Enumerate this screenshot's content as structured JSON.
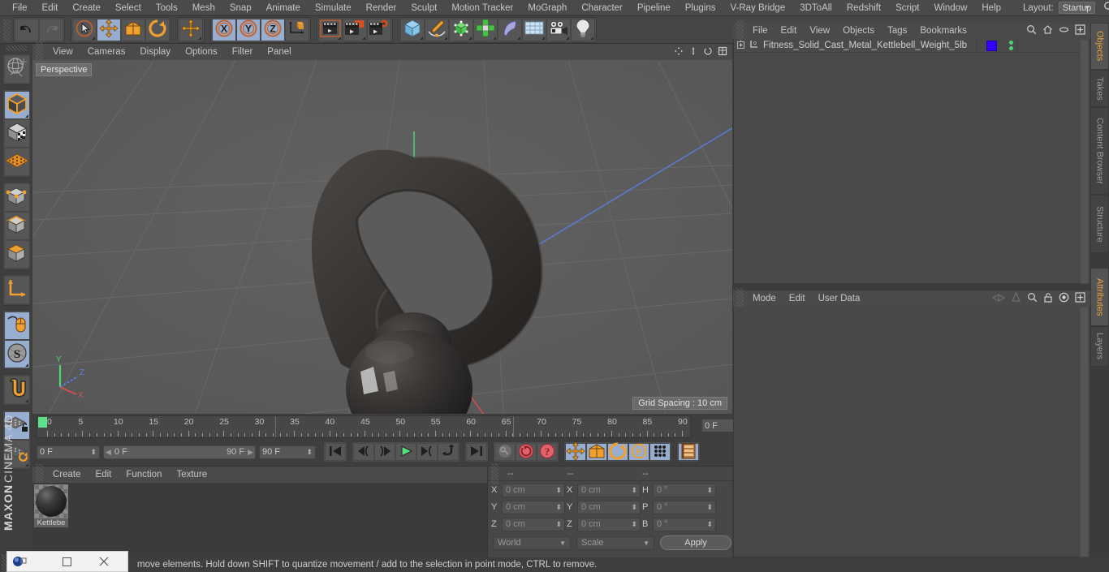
{
  "app": {
    "brand_top": "MAXON",
    "brand_bottom": "CINEMA 4D"
  },
  "menubar": {
    "items": [
      "File",
      "Edit",
      "Create",
      "Select",
      "Tools",
      "Mesh",
      "Snap",
      "Animate",
      "Simulate",
      "Render",
      "Sculpt",
      "Motion Tracker",
      "MoGraph",
      "Character",
      "Pipeline",
      "Plugins",
      "V-Ray Bridge",
      "3DToAll",
      "Redshift",
      "Script",
      "Window",
      "Help"
    ],
    "layout_label": "Layout:",
    "layout_value": "Startup",
    "search_icon": "search-icon"
  },
  "toolbar": {
    "groups": [
      {
        "name": "undo-redo",
        "buttons": [
          {
            "name": "undo-button",
            "icon": "undo-arrow-icon",
            "active": false,
            "corner": false
          },
          {
            "name": "redo-button",
            "icon": "redo-arrow-icon",
            "active": false,
            "corner": false
          }
        ]
      },
      {
        "name": "transform-tools",
        "buttons": [
          {
            "name": "select-tool",
            "icon": "cursor-circle-icon",
            "active": false,
            "corner": true
          },
          {
            "name": "move-tool",
            "icon": "move-arrows-icon",
            "active": true,
            "corner": false
          },
          {
            "name": "scale-tool",
            "icon": "scale-box-icon",
            "active": false,
            "corner": false
          },
          {
            "name": "rotate-tool",
            "icon": "rotate-circle-icon",
            "active": false,
            "corner": false
          }
        ]
      },
      {
        "name": "cursor-group",
        "buttons": [
          {
            "name": "move-cursor-tool",
            "icon": "move-arrows-icon",
            "active": false,
            "corner": true
          }
        ]
      },
      {
        "name": "axis-locks",
        "buttons": [
          {
            "name": "lock-x-axis",
            "icon": "x-axis-icon",
            "active": true,
            "corner": false
          },
          {
            "name": "lock-y-axis",
            "icon": "y-axis-icon",
            "active": true,
            "corner": false
          },
          {
            "name": "lock-z-axis",
            "icon": "z-axis-icon",
            "active": true,
            "corner": false
          },
          {
            "name": "world-object-coordinates",
            "icon": "world-axis-cube-icon",
            "active": false,
            "corner": false
          }
        ]
      },
      {
        "name": "render-group",
        "buttons": [
          {
            "name": "render-view-button",
            "icon": "clapboard-frame-icon",
            "active": false,
            "corner": true
          },
          {
            "name": "render-to-picture-viewer-button",
            "icon": "clapboard-picture-icon",
            "active": false,
            "corner": true
          },
          {
            "name": "render-settings-button",
            "icon": "clapboard-gear-icon",
            "active": false,
            "corner": false
          }
        ]
      },
      {
        "name": "create-group",
        "buttons": [
          {
            "name": "add-cube-primitive",
            "icon": "blue-cube-icon",
            "active": false,
            "corner": true
          },
          {
            "name": "add-spline",
            "icon": "pen-spline-icon",
            "active": false,
            "corner": true
          },
          {
            "name": "add-generator",
            "icon": "green-cube-icon",
            "active": false,
            "corner": true
          },
          {
            "name": "add-mograph-cloner",
            "icon": "green-cluster-icon",
            "active": false,
            "corner": true
          },
          {
            "name": "add-deformer",
            "icon": "bend-deformer-icon",
            "active": false,
            "corner": true
          },
          {
            "name": "add-environment",
            "icon": "floor-grid-icon",
            "active": false,
            "corner": true
          },
          {
            "name": "add-camera",
            "icon": "camera-icon",
            "active": false,
            "corner": true
          },
          {
            "name": "add-light",
            "icon": "light-bulb-icon",
            "active": false,
            "corner": true
          }
        ]
      }
    ]
  },
  "left_tools": [
    {
      "name": "live-selection-tool",
      "icon": "globe-sphere-icon",
      "active": false,
      "corner": false
    },
    {
      "name": "model-mode-tool",
      "icon": "orange-outline-cube-icon",
      "active": true,
      "corner": true
    },
    {
      "name": "texture-mode-tool",
      "icon": "checker-cube-icon",
      "active": false,
      "corner": false
    },
    {
      "name": "uv-mesh-tool",
      "icon": "orange-grid-mesh-icon",
      "active": false,
      "corner": false
    },
    {
      "name": "points-mode-tool",
      "icon": "points-cube-icon",
      "active": false,
      "corner": false
    },
    {
      "name": "edges-mode-tool",
      "icon": "edges-cube-icon",
      "active": false,
      "corner": false
    },
    {
      "name": "polygons-mode-tool",
      "icon": "polygon-cube-icon",
      "active": false,
      "corner": false
    },
    {
      "name": "axis-modify-tool",
      "icon": "orange-axis-icon",
      "active": false,
      "corner": false
    },
    {
      "name": "viewport-solo-tool",
      "icon": "mouse-icon",
      "active": true,
      "corner": false
    },
    {
      "name": "enable-snapping-tool",
      "icon": "s-snap-icon",
      "active": true,
      "corner": true
    },
    {
      "name": "magnet-tool",
      "icon": "orange-magnet-icon",
      "active": false,
      "corner": true
    },
    {
      "name": "lock-workplane-tool",
      "icon": "workplane-lock-icon",
      "active": true,
      "corner": false
    },
    {
      "name": "workplane-rotate-tool",
      "icon": "workplane-rotate-icon",
      "active": false,
      "corner": true
    }
  ],
  "viewport": {
    "menu": [
      "View",
      "Cameras",
      "Display",
      "Options",
      "Filter",
      "Panel"
    ],
    "label": "Perspective",
    "grid_spacing": "Grid Spacing : 10 cm",
    "axis_labels": {
      "x": "X",
      "y": "Y",
      "z": "Z"
    },
    "axis_colors": {
      "x": "#d94f4f",
      "y": "#4fd472",
      "z": "#5b7fe0"
    },
    "corner_icons": [
      "pan-view-icon",
      "zoom-view-icon",
      "rotate-view-icon",
      "maximize-view-icon"
    ]
  },
  "timeline": {
    "tick_labels": [
      "0",
      "5",
      "10",
      "15",
      "20",
      "25",
      "30",
      "35",
      "40",
      "45",
      "50",
      "55",
      "60",
      "65",
      "70",
      "75",
      "80",
      "85",
      "90"
    ],
    "current_frame_field": "0 F",
    "start_field": "0 F",
    "range_start": "0 F",
    "range_end": "90 F",
    "end_field": "90 F",
    "buttons": [
      {
        "name": "go-to-start-button",
        "icon": "skip-start-icon",
        "active": false
      },
      {
        "name": "play-backwards-frame-button",
        "icon": "step-back-icon",
        "active": false
      },
      {
        "name": "go-to-previous-key-button",
        "icon": "prev-key-icon",
        "active": false
      },
      {
        "name": "play-button",
        "icon": "play-icon",
        "active": false
      },
      {
        "name": "go-to-next-key-button",
        "icon": "next-key-icon",
        "active": false
      },
      {
        "name": "play-forwards-button",
        "icon": "loop-arrow-icon",
        "active": false
      },
      {
        "name": "go-to-end-button",
        "icon": "skip-end-icon",
        "active": false
      },
      {
        "name": "record-active-objects-button",
        "icon": "key-icon",
        "active": false
      },
      {
        "name": "autokeying-button",
        "icon": "red-circle-arrow-icon",
        "active": false
      },
      {
        "name": "keyframe-selection-button",
        "icon": "red-question-icon",
        "active": false
      },
      {
        "name": "record-position-button",
        "icon": "move-arrows-icon",
        "active": true
      },
      {
        "name": "record-scale-button",
        "icon": "scale-box-icon",
        "active": true
      },
      {
        "name": "record-rotation-button",
        "icon": "rotate-circle-icon",
        "active": true
      },
      {
        "name": "record-pla-button",
        "icon": "p-circle-icon",
        "active": true
      },
      {
        "name": "record-parameter-button",
        "icon": "dots-grid-icon",
        "active": true
      },
      {
        "name": "timeline-filter-button",
        "icon": "film-strip-icon",
        "active": true
      }
    ]
  },
  "material_manager": {
    "menu": [
      "Create",
      "Edit",
      "Function",
      "Texture"
    ],
    "materials": [
      {
        "name": "Kettlebe"
      }
    ]
  },
  "coordinates": {
    "header_cols": [
      "--",
      "--",
      "--"
    ],
    "position_label": "X",
    "rows": [
      {
        "label_a": "X",
        "value_a": "0 cm",
        "label_b": "X",
        "value_b": "0 cm",
        "label_c": "H",
        "value_c": "0 °"
      },
      {
        "label_a": "Y",
        "value_a": "0 cm",
        "label_b": "Y",
        "value_b": "0 cm",
        "label_c": "P",
        "value_c": "0 °"
      },
      {
        "label_a": "Z",
        "value_a": "0 cm",
        "label_b": "Z",
        "value_b": "0 cm",
        "label_c": "B",
        "value_c": "0 °"
      }
    ],
    "system": "World",
    "mode": "Scale",
    "apply_label": "Apply"
  },
  "object_manager": {
    "menu": [
      "File",
      "Edit",
      "View",
      "Objects",
      "Tags",
      "Bookmarks"
    ],
    "icons": [
      "search-icon",
      "home-icon",
      "ellipse-icon",
      "plus-box-icon"
    ],
    "rows": [
      {
        "name": "Fitness_Solid_Cast_Metal_Kettlebell_Weight_5lb",
        "tag_color": "#3300ff",
        "dot_color": "#4fd472"
      }
    ]
  },
  "attributes": {
    "menu": [
      "Mode",
      "Edit",
      "User Data"
    ],
    "icons": [
      "layers-icon",
      "cone-icon",
      "search-icon",
      "lock-icon",
      "target-icon",
      "plus-box-icon"
    ]
  },
  "right_tabs_top": [
    {
      "label": "Objects",
      "selected": true
    },
    {
      "label": "Takes",
      "selected": false
    },
    {
      "label": "Content Browser",
      "selected": false
    },
    {
      "label": "Structure",
      "selected": false
    }
  ],
  "right_tabs_bottom": [
    {
      "label": "Attributes",
      "selected": true
    },
    {
      "label": "Layers",
      "selected": false
    }
  ],
  "statusbar": {
    "text": "move elements. Hold down SHIFT to quantize movement / add to the selection in point mode, CTRL to remove."
  },
  "taskbar": {
    "app_icon": "cinema4d-logo-icon",
    "restore_icon": "restore-window-icon",
    "maximize_icon": "maximize-window-icon",
    "close_icon": "close-window-icon"
  }
}
